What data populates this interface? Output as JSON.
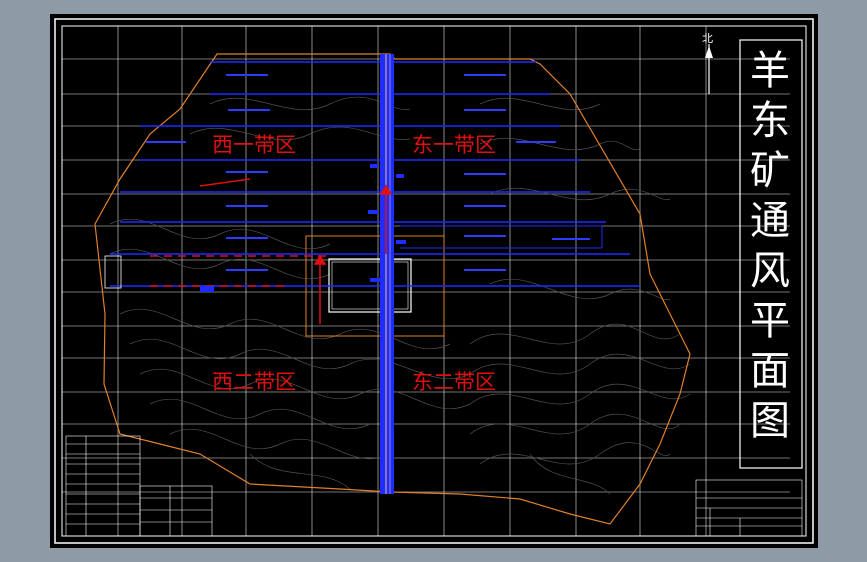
{
  "drawing_title": "羊东矿通风平面图",
  "north_label": "北",
  "zones": {
    "west_one": "西一带区",
    "east_one": "东一带区",
    "west_two": "西二带区",
    "east_two": "东二带区"
  },
  "colors": {
    "background": "#000000",
    "viewer_frame": "#8e9aa6",
    "grid": "#ffffff",
    "boundary": "#e0802a",
    "workings": "#1e2cff",
    "airway": "#e8c070",
    "zone_text": "#e01010",
    "contours": "#505050"
  },
  "icons": [
    "north-arrow-icon",
    "zoom-bar-icon"
  ]
}
